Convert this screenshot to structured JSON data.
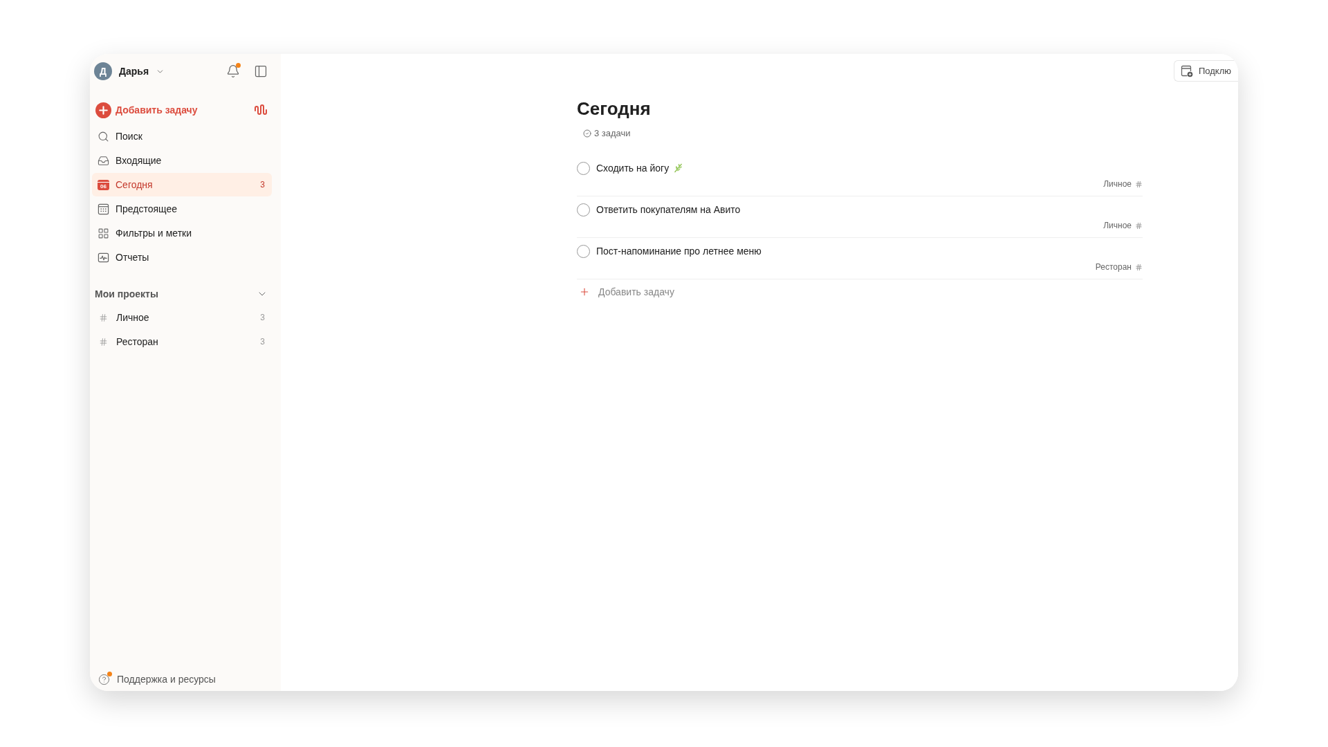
{
  "user": {
    "initial": "Д",
    "name": "Дарья"
  },
  "notifications": {
    "unread": true
  },
  "sidebar_add_task": {
    "label": "Добавить задачу"
  },
  "nav": [
    {
      "kind": "search",
      "label": "Поиск",
      "selected": false
    },
    {
      "kind": "inbox",
      "label": "Входящие",
      "selected": false
    },
    {
      "kind": "today",
      "label": "Сегодня",
      "day": "06",
      "count": "3",
      "selected": true
    },
    {
      "kind": "upcoming",
      "label": "Предстоящее",
      "selected": false
    },
    {
      "kind": "filters",
      "label": "Фильтры и метки",
      "selected": false
    },
    {
      "kind": "reports",
      "label": "Отчеты",
      "selected": false
    }
  ],
  "projects": {
    "title": "Мои проекты",
    "expanded": true,
    "items": [
      {
        "name": "Личное",
        "count": "3",
        "selected": false
      },
      {
        "name": "Ресторан",
        "count": "3",
        "selected": false
      }
    ]
  },
  "support": {
    "label": "Поддержка и ресурсы",
    "unread": true
  },
  "top_button": {
    "label": "Подклю"
  },
  "page": {
    "title": "Сегодня",
    "summary": "3 задачи",
    "tasks": [
      {
        "title": "Сходить на йогу",
        "emoji": true,
        "completed": false,
        "project": "Личное"
      },
      {
        "title": "Ответить покупателям на Авито",
        "emoji": false,
        "completed": false,
        "project": "Личное"
      },
      {
        "title": "Пост-напоминание про летнее меню",
        "emoji": false,
        "completed": false,
        "project": "Ресторан"
      }
    ],
    "add_task": "Добавить задачу"
  }
}
